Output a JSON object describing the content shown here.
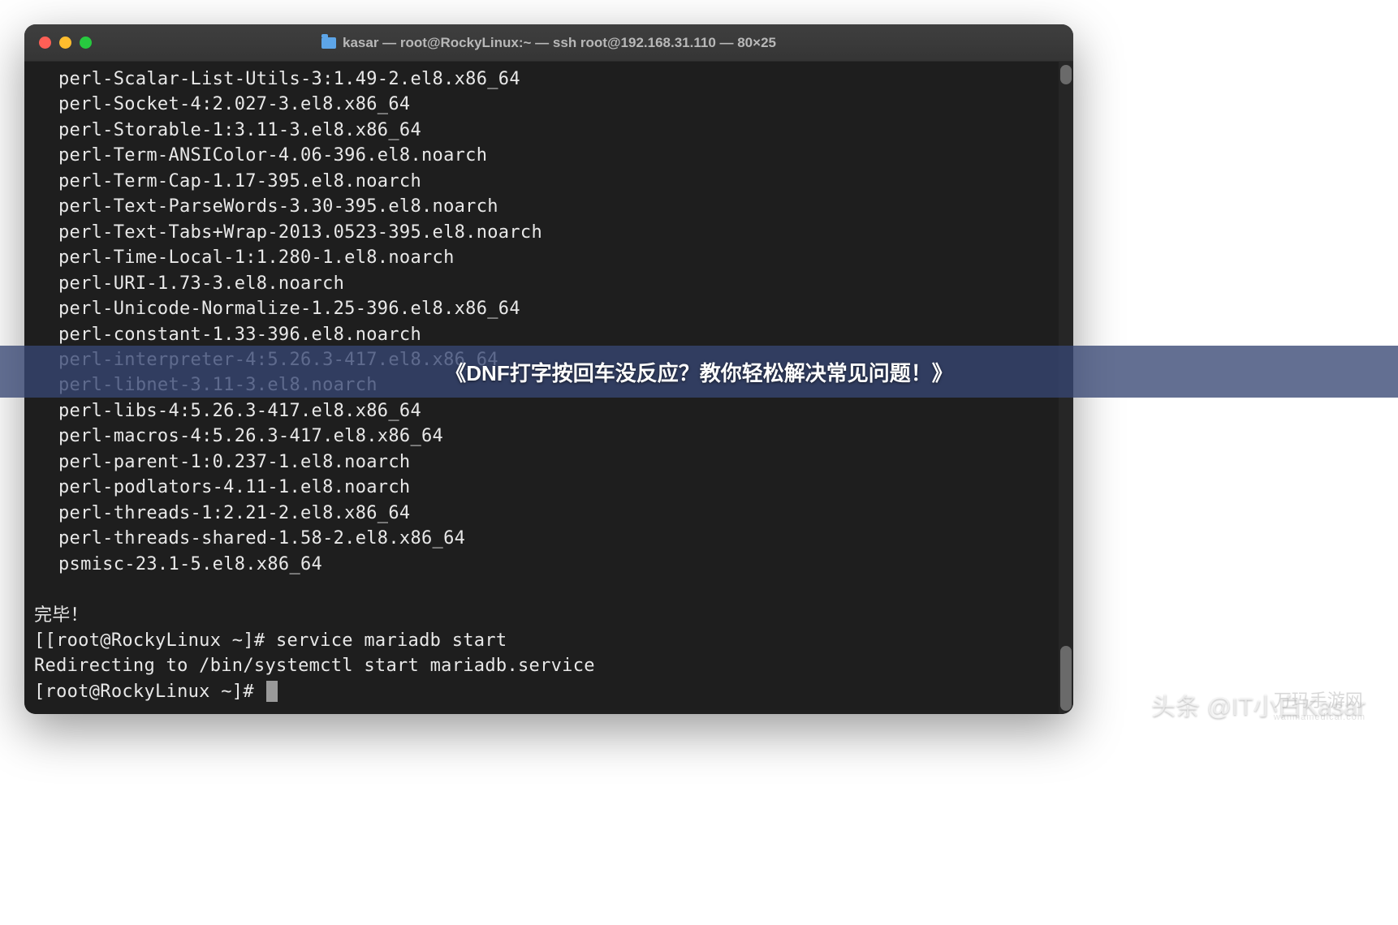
{
  "window": {
    "title": "kasar — root@RockyLinux:~ — ssh root@192.168.31.110 — 80×25"
  },
  "packages": [
    "perl-Scalar-List-Utils-3:1.49-2.el8.x86_64",
    "perl-Socket-4:2.027-3.el8.x86_64",
    "perl-Storable-1:3.11-3.el8.x86_64",
    "perl-Term-ANSIColor-4.06-396.el8.noarch",
    "perl-Term-Cap-1.17-395.el8.noarch",
    "perl-Text-ParseWords-3.30-395.el8.noarch",
    "perl-Text-Tabs+Wrap-2013.0523-395.el8.noarch",
    "perl-Time-Local-1:1.280-1.el8.noarch",
    "perl-URI-1.73-3.el8.noarch",
    "perl-Unicode-Normalize-1.25-396.el8.x86_64",
    "perl-constant-1.33-396.el8.noarch",
    "perl-interpreter-4:5.26.3-417.el8.x86_64",
    "perl-libnet-3.11-3.el8.noarch",
    "perl-libs-4:5.26.3-417.el8.x86_64",
    "perl-macros-4:5.26.3-417.el8.x86_64",
    "perl-parent-1:0.237-1.el8.noarch",
    "perl-podlators-4.11-1.el8.noarch",
    "perl-threads-1:2.21-2.el8.x86_64",
    "perl-threads-shared-1.58-2.el8.x86_64",
    "psmisc-23.1-5.el8.x86_64"
  ],
  "complete_msg": "完毕！",
  "prompt1": {
    "prefix": "[[root@RockyLinux ~]# ",
    "command": "service mariadb start"
  },
  "redirect_msg": "Redirecting to /bin/systemctl start mariadb.service",
  "prompt2": {
    "prefix": "[root@RockyLinux ~]# "
  },
  "overlay": {
    "text": "《DNF打字按回车没反应？教你轻松解决常见问题！》"
  },
  "watermarks": {
    "toutiao": "头条 @IT小白Kasar",
    "site": "万玛手游网",
    "site_sub": "wanmamedical.com"
  }
}
